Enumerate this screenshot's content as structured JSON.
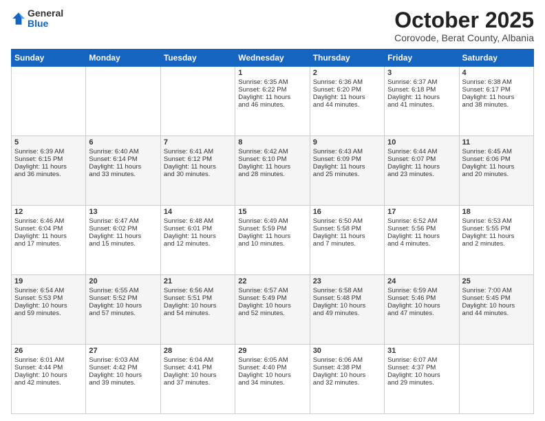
{
  "logo": {
    "general": "General",
    "blue": "Blue"
  },
  "header": {
    "month": "October 2025",
    "location": "Corovode, Berat County, Albania"
  },
  "weekdays": [
    "Sunday",
    "Monday",
    "Tuesday",
    "Wednesday",
    "Thursday",
    "Friday",
    "Saturday"
  ],
  "weeks": [
    [
      {
        "day": "",
        "info": ""
      },
      {
        "day": "",
        "info": ""
      },
      {
        "day": "",
        "info": ""
      },
      {
        "day": "1",
        "info": "Sunrise: 6:35 AM\nSunset: 6:22 PM\nDaylight: 11 hours\nand 46 minutes."
      },
      {
        "day": "2",
        "info": "Sunrise: 6:36 AM\nSunset: 6:20 PM\nDaylight: 11 hours\nand 44 minutes."
      },
      {
        "day": "3",
        "info": "Sunrise: 6:37 AM\nSunset: 6:18 PM\nDaylight: 11 hours\nand 41 minutes."
      },
      {
        "day": "4",
        "info": "Sunrise: 6:38 AM\nSunset: 6:17 PM\nDaylight: 11 hours\nand 38 minutes."
      }
    ],
    [
      {
        "day": "5",
        "info": "Sunrise: 6:39 AM\nSunset: 6:15 PM\nDaylight: 11 hours\nand 36 minutes."
      },
      {
        "day": "6",
        "info": "Sunrise: 6:40 AM\nSunset: 6:14 PM\nDaylight: 11 hours\nand 33 minutes."
      },
      {
        "day": "7",
        "info": "Sunrise: 6:41 AM\nSunset: 6:12 PM\nDaylight: 11 hours\nand 30 minutes."
      },
      {
        "day": "8",
        "info": "Sunrise: 6:42 AM\nSunset: 6:10 PM\nDaylight: 11 hours\nand 28 minutes."
      },
      {
        "day": "9",
        "info": "Sunrise: 6:43 AM\nSunset: 6:09 PM\nDaylight: 11 hours\nand 25 minutes."
      },
      {
        "day": "10",
        "info": "Sunrise: 6:44 AM\nSunset: 6:07 PM\nDaylight: 11 hours\nand 23 minutes."
      },
      {
        "day": "11",
        "info": "Sunrise: 6:45 AM\nSunset: 6:06 PM\nDaylight: 11 hours\nand 20 minutes."
      }
    ],
    [
      {
        "day": "12",
        "info": "Sunrise: 6:46 AM\nSunset: 6:04 PM\nDaylight: 11 hours\nand 17 minutes."
      },
      {
        "day": "13",
        "info": "Sunrise: 6:47 AM\nSunset: 6:02 PM\nDaylight: 11 hours\nand 15 minutes."
      },
      {
        "day": "14",
        "info": "Sunrise: 6:48 AM\nSunset: 6:01 PM\nDaylight: 11 hours\nand 12 minutes."
      },
      {
        "day": "15",
        "info": "Sunrise: 6:49 AM\nSunset: 5:59 PM\nDaylight: 11 hours\nand 10 minutes."
      },
      {
        "day": "16",
        "info": "Sunrise: 6:50 AM\nSunset: 5:58 PM\nDaylight: 11 hours\nand 7 minutes."
      },
      {
        "day": "17",
        "info": "Sunrise: 6:52 AM\nSunset: 5:56 PM\nDaylight: 11 hours\nand 4 minutes."
      },
      {
        "day": "18",
        "info": "Sunrise: 6:53 AM\nSunset: 5:55 PM\nDaylight: 11 hours\nand 2 minutes."
      }
    ],
    [
      {
        "day": "19",
        "info": "Sunrise: 6:54 AM\nSunset: 5:53 PM\nDaylight: 10 hours\nand 59 minutes."
      },
      {
        "day": "20",
        "info": "Sunrise: 6:55 AM\nSunset: 5:52 PM\nDaylight: 10 hours\nand 57 minutes."
      },
      {
        "day": "21",
        "info": "Sunrise: 6:56 AM\nSunset: 5:51 PM\nDaylight: 10 hours\nand 54 minutes."
      },
      {
        "day": "22",
        "info": "Sunrise: 6:57 AM\nSunset: 5:49 PM\nDaylight: 10 hours\nand 52 minutes."
      },
      {
        "day": "23",
        "info": "Sunrise: 6:58 AM\nSunset: 5:48 PM\nDaylight: 10 hours\nand 49 minutes."
      },
      {
        "day": "24",
        "info": "Sunrise: 6:59 AM\nSunset: 5:46 PM\nDaylight: 10 hours\nand 47 minutes."
      },
      {
        "day": "25",
        "info": "Sunrise: 7:00 AM\nSunset: 5:45 PM\nDaylight: 10 hours\nand 44 minutes."
      }
    ],
    [
      {
        "day": "26",
        "info": "Sunrise: 6:01 AM\nSunset: 4:44 PM\nDaylight: 10 hours\nand 42 minutes."
      },
      {
        "day": "27",
        "info": "Sunrise: 6:03 AM\nSunset: 4:42 PM\nDaylight: 10 hours\nand 39 minutes."
      },
      {
        "day": "28",
        "info": "Sunrise: 6:04 AM\nSunset: 4:41 PM\nDaylight: 10 hours\nand 37 minutes."
      },
      {
        "day": "29",
        "info": "Sunrise: 6:05 AM\nSunset: 4:40 PM\nDaylight: 10 hours\nand 34 minutes."
      },
      {
        "day": "30",
        "info": "Sunrise: 6:06 AM\nSunset: 4:38 PM\nDaylight: 10 hours\nand 32 minutes."
      },
      {
        "day": "31",
        "info": "Sunrise: 6:07 AM\nSunset: 4:37 PM\nDaylight: 10 hours\nand 29 minutes."
      },
      {
        "day": "",
        "info": ""
      }
    ]
  ]
}
